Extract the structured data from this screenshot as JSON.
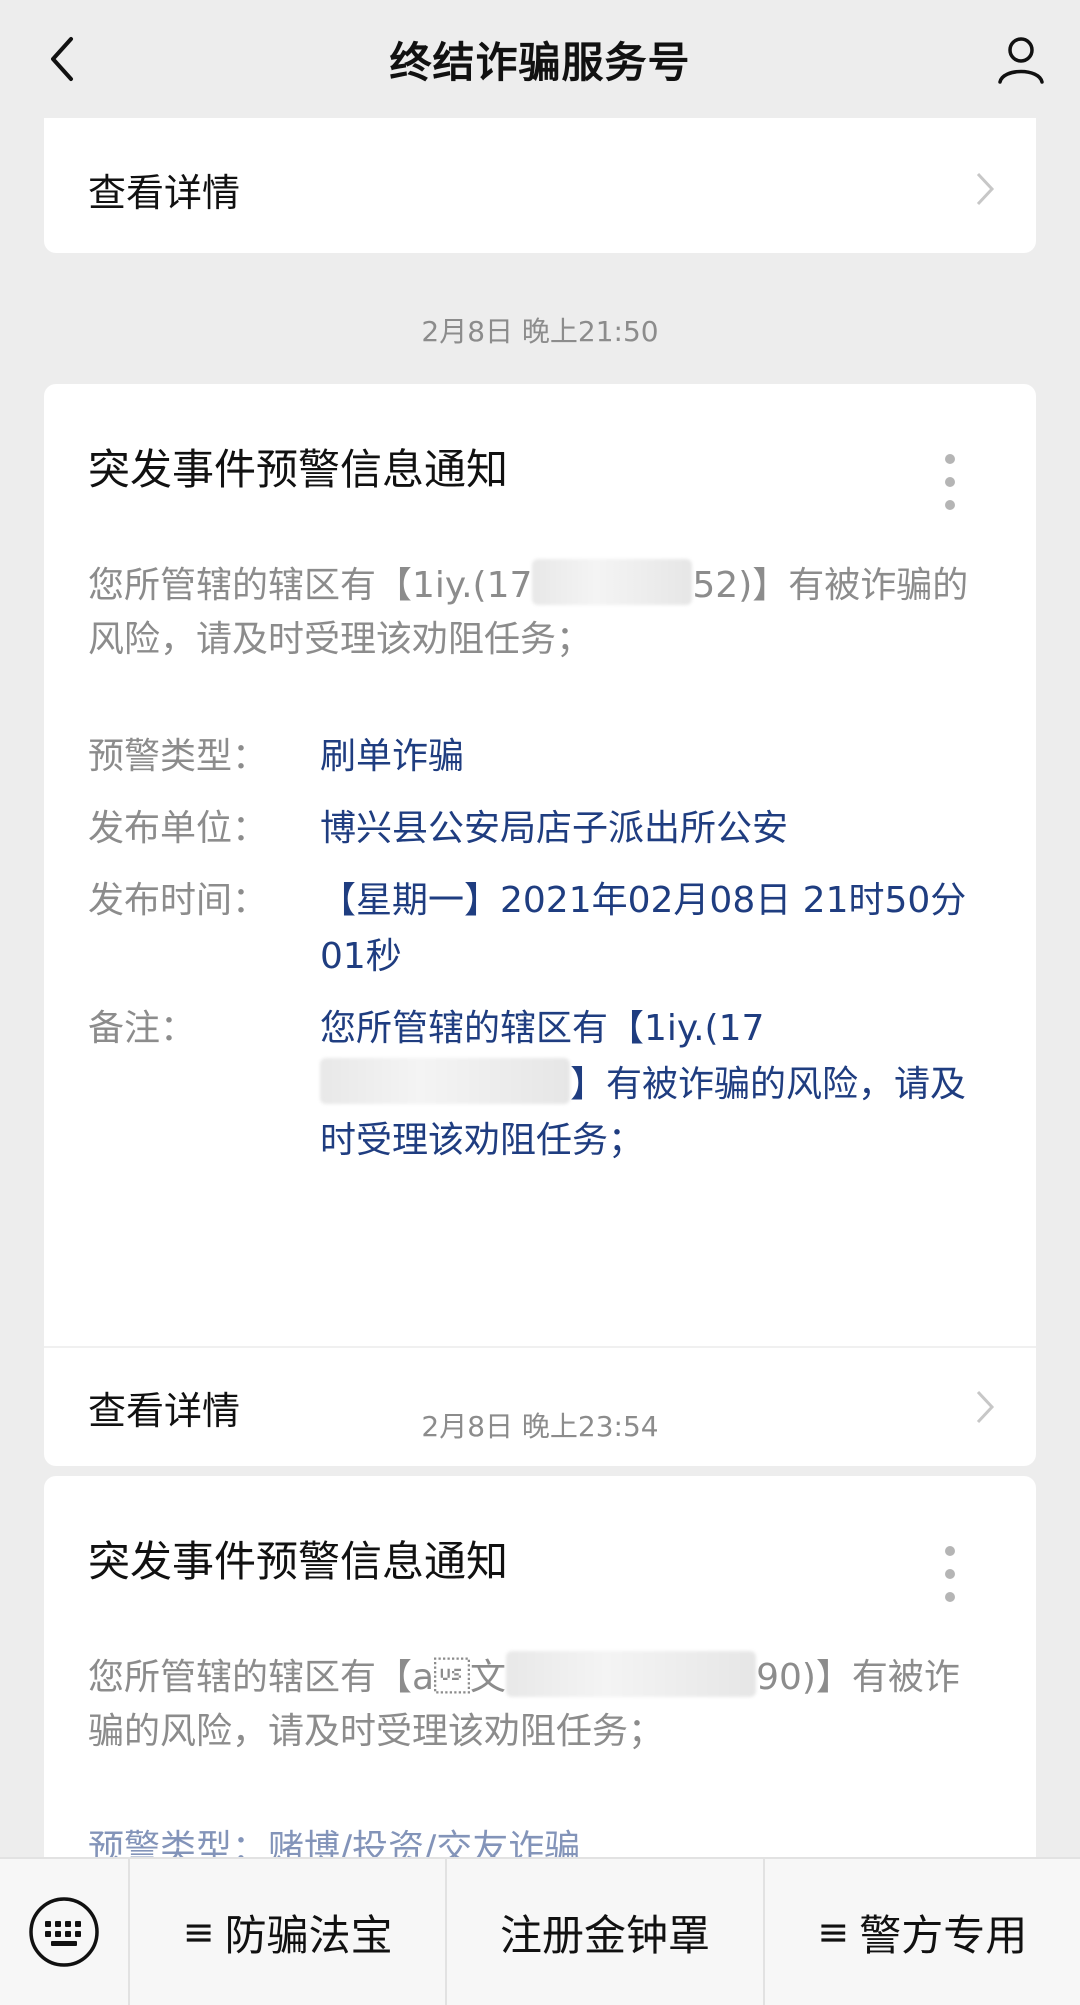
{
  "header": {
    "title": "终结诈骗服务号",
    "back_icon": "back-arrow-icon",
    "profile_icon": "person-icon"
  },
  "partial_card": {
    "detail_label": "查看详情"
  },
  "messages": [
    {
      "timestamp": "2月8日 晚上21:50",
      "title": "突发事件预警信息通知",
      "summary_prefix": "您所管辖的辖区有【1iy.(17",
      "summary_suffix": "52)】有被诈骗的风险，请及时受理该劝阻任务；",
      "fields": [
        {
          "label": "预警类型：",
          "value": "刷单诈骗"
        },
        {
          "label": "发布单位：",
          "value": "博兴县公安局店子派出所公安"
        },
        {
          "label": "发布时间：",
          "value": "【星期一】2021年02月08日 21时50分01秒"
        },
        {
          "label": "备注：",
          "value_prefix": "您所管辖的辖区有【1iy.(17",
          "value_suffix": "】有被诈骗的风险，请及时受理该劝阻任务；"
        }
      ],
      "detail_label": "查看详情"
    },
    {
      "timestamp": "2月8日 晚上23:54",
      "title": "突发事件预警信息通知",
      "summary_prefix": "您所管辖的辖区有【a\u001f文",
      "summary_suffix": "90)】有被诈骗的风险，请及时受理该劝阻任务；",
      "partial_field": "预警类型：赌博/投资/交友诈骗"
    }
  ],
  "bottom_menu": {
    "keyboard_icon": "keyboard-icon",
    "items": [
      {
        "label": "防骗法宝",
        "has_prefix": true
      },
      {
        "label": "注册金钟罩",
        "has_prefix": false
      },
      {
        "label": "警方专用",
        "has_prefix": true
      }
    ],
    "prefix_symbol": "≡"
  }
}
